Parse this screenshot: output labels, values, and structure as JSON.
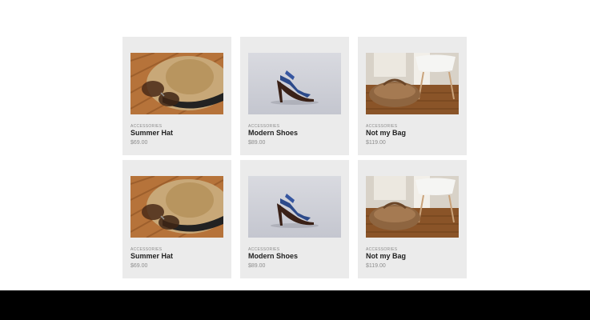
{
  "products": [
    {
      "category": "Accessories",
      "name": "Summer Hat",
      "price": "$69.00",
      "image": "hat-image"
    },
    {
      "category": "Accessories",
      "name": "Modern Shoes",
      "price": "$89.00",
      "image": "shoe-image"
    },
    {
      "category": "Accessories",
      "name": "Not my Bag",
      "price": "$119.00",
      "image": "bag-image"
    },
    {
      "category": "Accessories",
      "name": "Summer Hat",
      "price": "$69.00",
      "image": "hat-image"
    },
    {
      "category": "Accessories",
      "name": "Modern Shoes",
      "price": "$89.00",
      "image": "shoe-image"
    },
    {
      "category": "Accessories",
      "name": "Not my Bag",
      "price": "$119.00",
      "image": "bag-image"
    }
  ]
}
